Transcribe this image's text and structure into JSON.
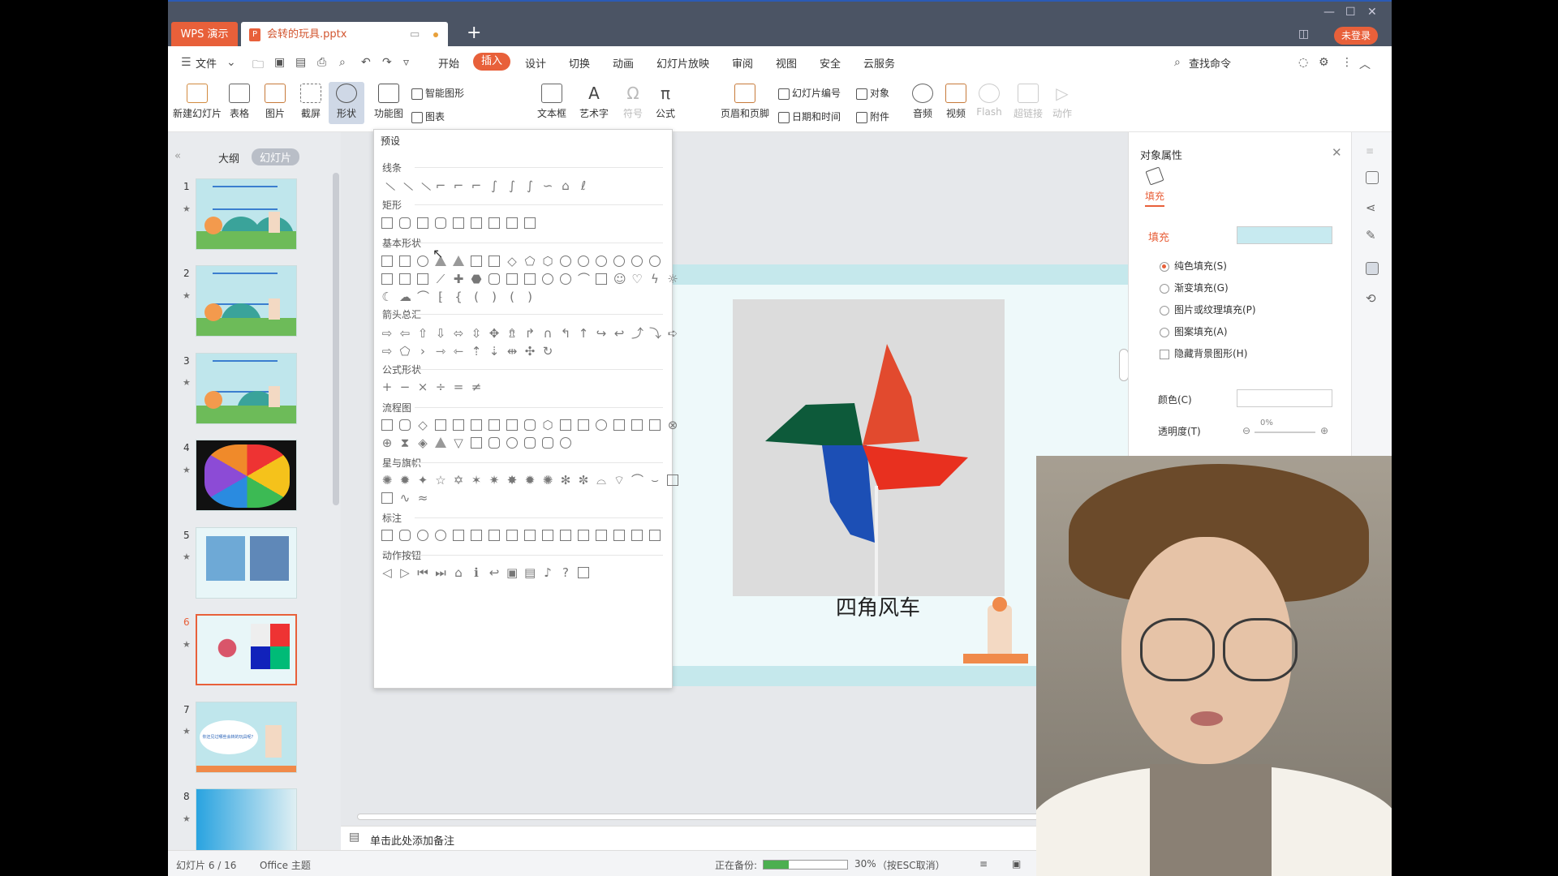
{
  "titlebar": {
    "brand": "WPS 演示",
    "doc_tab": "会转的玩具.pptx",
    "login": "未登录"
  },
  "menubar": {
    "file": "文件",
    "tabs": [
      "开始",
      "插入",
      "设计",
      "切换",
      "动画",
      "幻灯片放映",
      "审阅",
      "视图",
      "安全",
      "云服务"
    ],
    "active_tab": "插入",
    "search": "查找命令"
  },
  "ribbon": {
    "new_slide": "新建幻灯片",
    "table": "表格",
    "picture": "图片",
    "screenshot": "截屏",
    "shape": "形状",
    "function_diagram": "功能图",
    "smart_graphic": "智能图形",
    "chart": "图表",
    "textbox": "文本框",
    "wordart": "艺术字",
    "symbol": "符号",
    "formula": "公式",
    "header_footer": "页眉和页脚",
    "slide_number": "幻灯片编号",
    "object": "对象",
    "date_time": "日期和时间",
    "attachment": "附件",
    "audio": "音频",
    "video": "视频",
    "flash": "Flash",
    "hyperlink": "超链接",
    "action": "动作"
  },
  "leftpanel": {
    "tab_outline": "大纲",
    "tab_slides": "幻灯片",
    "slides": [
      "1",
      "2",
      "3",
      "4",
      "5",
      "6",
      "7",
      "8"
    ],
    "selected": "6",
    "thumb1_title": "会转的玩具",
    "thumb7_text": "你还见过哪些会转的玩具呢？"
  },
  "shapes_dropdown": {
    "header": "预设",
    "sections": [
      "线条",
      "矩形",
      "基本形状",
      "箭头总汇",
      "公式形状",
      "流程图",
      "星与旗帜",
      "标注",
      "动作按钮"
    ]
  },
  "slide": {
    "caption": "四角风车"
  },
  "notes": {
    "placeholder": "单击此处添加备注"
  },
  "rightpanel": {
    "title": "对象属性",
    "tab": "填充",
    "section": "填充",
    "fill_color": "#c7eaf0",
    "options": [
      "纯色填充(S)",
      "渐变填充(G)",
      "图片或纹理填充(P)",
      "图案填充(A)"
    ],
    "selected_option": "纯色填充(S)",
    "hide_bg": "隐藏背景图形(H)",
    "color_label": "颜色(C)",
    "transparency_label": "透明度(T)",
    "transparency_value": "0%"
  },
  "statusbar": {
    "slide_info": "幻灯片 6 / 16",
    "theme": "Office 主题",
    "backup_label": "正在备份:",
    "progress": 0.3,
    "progress_text": "30%",
    "cancel_hint": "（按ESC取消）"
  },
  "colors": {
    "accent": "#e8603a",
    "titlebar": "#4b5464",
    "slide_bg": "#c5e8ec"
  }
}
